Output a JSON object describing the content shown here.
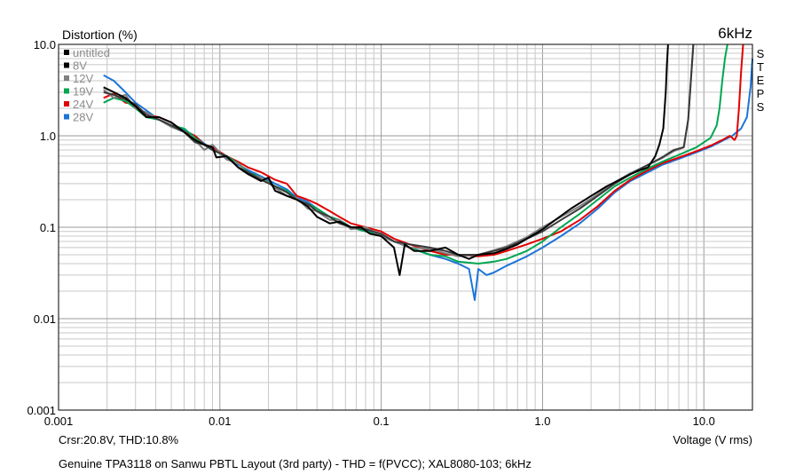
{
  "chart_data": {
    "type": "line",
    "ylabel": "Distortion (%)",
    "xlabel": "Voltage (V rms)",
    "frequency_label": "6kHz",
    "side_label": [
      "S",
      "T",
      "E",
      "P",
      "S"
    ],
    "cursor_readout": "Crsr:20.8V, THD:10.8%",
    "caption": "Genuine TPA3118 on Sanwu PBTL Layout (3rd party) - THD = f(PVCC); XAL8080-103; 6kHz",
    "x_scale": "log",
    "y_scale": "log",
    "xlim": [
      0.001,
      20
    ],
    "ylim": [
      0.001,
      10
    ],
    "x_ticks": [
      {
        "value": 0.001,
        "label": "0.001"
      },
      {
        "value": 0.01,
        "label": "0.01"
      },
      {
        "value": 0.1,
        "label": "0.1"
      },
      {
        "value": 1,
        "label": "1.0"
      },
      {
        "value": 10,
        "label": "10.0"
      }
    ],
    "y_ticks": [
      {
        "value": 0.001,
        "label": "0.001"
      },
      {
        "value": 0.01,
        "label": "0.01"
      },
      {
        "value": 0.1,
        "label": "0.1"
      },
      {
        "value": 1,
        "label": "1.0"
      },
      {
        "value": 10,
        "label": "10.0"
      }
    ],
    "grid": true,
    "legend_position": "top-left",
    "series": [
      {
        "name": "untitled",
        "color": "#000000",
        "legend_color": "#000000",
        "x": [
          0.0019,
          0.0022,
          0.0026,
          0.003,
          0.0035,
          0.0042,
          0.005,
          0.006,
          0.007,
          0.008,
          0.009,
          0.0095,
          0.011,
          0.013,
          0.015,
          0.018,
          0.02,
          0.022,
          0.026,
          0.03,
          0.035,
          0.04,
          0.048,
          0.055,
          0.065,
          0.075,
          0.085,
          0.1,
          0.12,
          0.13,
          0.14,
          0.16,
          0.2,
          0.25,
          0.3,
          0.35,
          0.4,
          0.5,
          0.6,
          0.7,
          0.8,
          1.0,
          1.2,
          1.5,
          2.0,
          2.5,
          3.0,
          3.5,
          4.0,
          4.5,
          5.0,
          5.3,
          5.6,
          5.8,
          5.9,
          6.0
        ],
        "y": [
          3.4,
          3.0,
          2.6,
          2.1,
          1.6,
          1.6,
          1.4,
          1.1,
          0.9,
          0.8,
          0.75,
          0.58,
          0.6,
          0.45,
          0.38,
          0.32,
          0.35,
          0.25,
          0.22,
          0.2,
          0.17,
          0.13,
          0.11,
          0.115,
          0.1,
          0.1,
          0.085,
          0.08,
          0.06,
          0.03,
          0.065,
          0.055,
          0.055,
          0.06,
          0.05,
          0.045,
          0.05,
          0.052,
          0.058,
          0.065,
          0.075,
          0.095,
          0.12,
          0.16,
          0.22,
          0.28,
          0.33,
          0.38,
          0.42,
          0.45,
          0.6,
          0.8,
          1.2,
          3.0,
          6.0,
          10.0
        ]
      },
      {
        "name": "8V",
        "color": "#3a3a3a",
        "legend_color": "#000000",
        "x": [
          0.0019,
          0.0022,
          0.0026,
          0.003,
          0.0035,
          0.0042,
          0.005,
          0.006,
          0.007,
          0.008,
          0.009,
          0.011,
          0.013,
          0.015,
          0.018,
          0.022,
          0.026,
          0.03,
          0.035,
          0.04,
          0.048,
          0.055,
          0.065,
          0.08,
          0.1,
          0.12,
          0.15,
          0.2,
          0.25,
          0.3,
          0.4,
          0.5,
          0.6,
          0.8,
          1.0,
          1.3,
          1.7,
          2.2,
          2.8,
          3.5,
          4.5,
          5.5,
          6.5,
          7.5,
          8.0,
          8.3,
          8.6
        ],
        "y": [
          3.0,
          2.8,
          2.5,
          2.2,
          1.7,
          1.5,
          1.3,
          1.1,
          0.85,
          0.8,
          0.7,
          0.6,
          0.45,
          0.4,
          0.33,
          0.28,
          0.24,
          0.2,
          0.18,
          0.15,
          0.13,
          0.11,
          0.1,
          0.095,
          0.085,
          0.07,
          0.065,
          0.06,
          0.055,
          0.05,
          0.05,
          0.055,
          0.06,
          0.075,
          0.09,
          0.12,
          0.16,
          0.22,
          0.3,
          0.38,
          0.48,
          0.58,
          0.7,
          0.75,
          1.5,
          4.0,
          10.0
        ]
      },
      {
        "name": "12V",
        "color": "#7f7f7f",
        "legend_color": "#7f7f7f",
        "x": [
          0.0019,
          0.0022,
          0.0026,
          0.003,
          0.0035,
          0.0042,
          0.005,
          0.006,
          0.007,
          0.008,
          0.009,
          0.011,
          0.013,
          0.015,
          0.018,
          0.022,
          0.026,
          0.03,
          0.035,
          0.04,
          0.048,
          0.055,
          0.065,
          0.08,
          0.1,
          0.12,
          0.15,
          0.2,
          0.25,
          0.3,
          0.4,
          0.5,
          0.6,
          0.8,
          1.0,
          1.3,
          1.7,
          2.2,
          2.8,
          3.5,
          4.5,
          5.5,
          6.5,
          7.5,
          8.0,
          8.3,
          8.6
        ],
        "y": [
          3.2,
          2.6,
          2.8,
          2.0,
          1.8,
          1.5,
          1.25,
          1.1,
          0.9,
          0.7,
          0.8,
          0.55,
          0.5,
          0.38,
          0.35,
          0.27,
          0.22,
          0.21,
          0.16,
          0.15,
          0.12,
          0.12,
          0.095,
          0.1,
          0.08,
          0.07,
          0.06,
          0.058,
          0.052,
          0.048,
          0.05,
          0.056,
          0.062,
          0.078,
          0.1,
          0.13,
          0.17,
          0.23,
          0.31,
          0.39,
          0.48,
          0.57,
          0.68,
          0.75,
          1.5,
          4.0,
          10.0
        ]
      },
      {
        "name": "19V",
        "color": "#00a651",
        "legend_color": "#00a651",
        "x": [
          0.0019,
          0.0022,
          0.0026,
          0.003,
          0.0035,
          0.0042,
          0.005,
          0.006,
          0.007,
          0.008,
          0.009,
          0.011,
          0.013,
          0.015,
          0.018,
          0.022,
          0.026,
          0.03,
          0.035,
          0.04,
          0.048,
          0.055,
          0.065,
          0.08,
          0.1,
          0.12,
          0.15,
          0.2,
          0.25,
          0.3,
          0.4,
          0.5,
          0.6,
          0.8,
          1.0,
          1.3,
          1.7,
          2.2,
          2.8,
          3.5,
          4.5,
          5.5,
          7.0,
          9.0,
          11.0,
          12.0,
          12.5,
          13.0,
          13.5,
          14.0
        ],
        "y": [
          2.3,
          2.6,
          2.4,
          2.0,
          1.6,
          1.5,
          1.3,
          1.2,
          0.95,
          0.8,
          0.7,
          0.6,
          0.5,
          0.4,
          0.35,
          0.28,
          0.25,
          0.2,
          0.18,
          0.16,
          0.13,
          0.12,
          0.1,
          0.09,
          0.08,
          0.07,
          0.06,
          0.05,
          0.048,
          0.042,
          0.04,
          0.042,
          0.045,
          0.055,
          0.07,
          0.1,
          0.14,
          0.2,
          0.28,
          0.35,
          0.44,
          0.52,
          0.62,
          0.75,
          0.95,
          1.3,
          2.0,
          4.0,
          7.0,
          10.0
        ]
      },
      {
        "name": "24V",
        "color": "#e30000",
        "legend_color": "#e30000",
        "x": [
          0.0019,
          0.0022,
          0.0026,
          0.003,
          0.0035,
          0.0042,
          0.005,
          0.006,
          0.007,
          0.008,
          0.009,
          0.011,
          0.013,
          0.015,
          0.018,
          0.022,
          0.026,
          0.03,
          0.035,
          0.04,
          0.048,
          0.055,
          0.065,
          0.08,
          0.1,
          0.12,
          0.15,
          0.2,
          0.25,
          0.3,
          0.4,
          0.5,
          0.6,
          0.8,
          1.0,
          1.3,
          1.7,
          2.2,
          2.8,
          3.5,
          4.5,
          5.5,
          7.0,
          9.0,
          11.0,
          13.0,
          14.5,
          15.5,
          16.0,
          16.5,
          17.0,
          17.5
        ],
        "y": [
          2.6,
          2.9,
          2.3,
          2.2,
          1.7,
          1.6,
          1.4,
          1.1,
          1.0,
          0.8,
          0.75,
          0.6,
          0.52,
          0.45,
          0.4,
          0.33,
          0.3,
          0.22,
          0.2,
          0.18,
          0.15,
          0.13,
          0.11,
          0.1,
          0.09,
          0.075,
          0.065,
          0.055,
          0.05,
          0.05,
          0.048,
          0.05,
          0.055,
          0.065,
          0.075,
          0.09,
          0.12,
          0.17,
          0.25,
          0.33,
          0.42,
          0.5,
          0.58,
          0.68,
          0.78,
          0.9,
          1.0,
          0.9,
          1.0,
          2.0,
          5.0,
          10.0
        ]
      },
      {
        "name": "28V",
        "color": "#1c75d8",
        "legend_color": "#1c75d8",
        "x": [
          0.0019,
          0.0022,
          0.0026,
          0.003,
          0.0035,
          0.0042,
          0.005,
          0.006,
          0.007,
          0.008,
          0.009,
          0.011,
          0.013,
          0.015,
          0.018,
          0.022,
          0.026,
          0.03,
          0.035,
          0.04,
          0.048,
          0.055,
          0.065,
          0.08,
          0.1,
          0.12,
          0.15,
          0.2,
          0.25,
          0.3,
          0.35,
          0.38,
          0.4,
          0.45,
          0.5,
          0.6,
          0.8,
          1.0,
          1.3,
          1.7,
          2.2,
          2.8,
          3.5,
          4.5,
          5.5,
          7.0,
          9.0,
          11.0,
          13.0,
          15.0,
          17.0,
          18.5,
          19.5,
          20.0
        ],
        "y": [
          4.6,
          4.0,
          3.0,
          2.3,
          1.9,
          1.5,
          1.3,
          1.15,
          1.0,
          0.82,
          0.72,
          0.58,
          0.48,
          0.42,
          0.36,
          0.3,
          0.26,
          0.21,
          0.19,
          0.16,
          0.13,
          0.12,
          0.1,
          0.09,
          0.085,
          0.07,
          0.06,
          0.05,
          0.045,
          0.04,
          0.035,
          0.016,
          0.035,
          0.03,
          0.032,
          0.038,
          0.048,
          0.06,
          0.08,
          0.11,
          0.16,
          0.24,
          0.32,
          0.4,
          0.48,
          0.56,
          0.66,
          0.76,
          0.88,
          1.0,
          1.2,
          1.6,
          3.5,
          7.0
        ]
      }
    ]
  }
}
